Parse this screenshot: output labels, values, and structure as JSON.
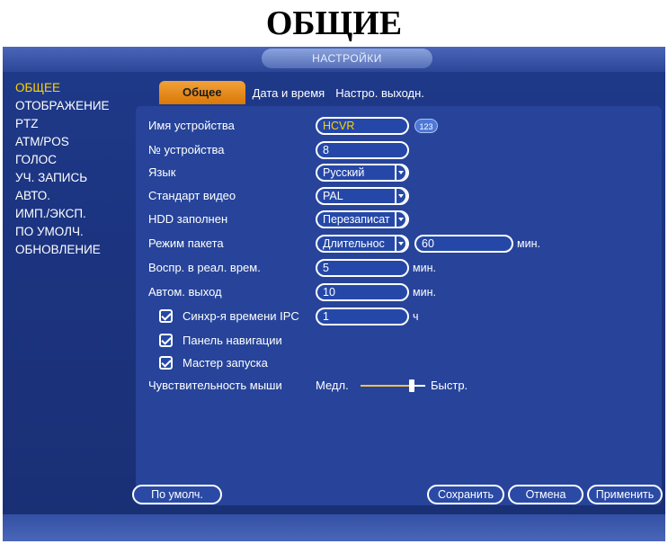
{
  "page_heading": "ОБЩИЕ",
  "window_title": "НАСТРОЙКИ",
  "sidebar": {
    "items": [
      {
        "label": "ОБЩЕЕ",
        "active": true
      },
      {
        "label": "ОТОБРАЖЕНИЕ"
      },
      {
        "label": "PTZ"
      },
      {
        "label": "ATM/POS"
      },
      {
        "label": "ГОЛОС"
      },
      {
        "label": "УЧ. ЗАПИСЬ"
      },
      {
        "label": "АВТО."
      },
      {
        "label": "ИМП./ЭКСП."
      },
      {
        "label": "ПО УМОЛЧ."
      },
      {
        "label": "ОБНОВЛЕНИЕ"
      }
    ]
  },
  "tabs": [
    {
      "label": "Общее",
      "active": true
    },
    {
      "label": "Дата и время"
    },
    {
      "label": "Настро. выходн."
    }
  ],
  "form": {
    "device_name": {
      "label": "Имя устройства",
      "value": "HCVR",
      "keyboard_badge": "123"
    },
    "device_number": {
      "label": "№ устройства",
      "value": "8"
    },
    "language": {
      "label": "Язык",
      "value": "Русский"
    },
    "video_standard": {
      "label": "Стандарт видео",
      "value": "PAL"
    },
    "hdd_full": {
      "label": "HDD заполнен",
      "value": "Перезаписат"
    },
    "pack_mode": {
      "label": "Режим пакета",
      "value": "Длительнос",
      "duration": "60",
      "unit": "мин."
    },
    "realtime_play": {
      "label": "Воспр. в реал. врем.",
      "value": "5",
      "unit": "мин."
    },
    "auto_logout": {
      "label": "Автом. выход",
      "value": "10",
      "unit": "мин."
    },
    "ipc_time_sync": {
      "label": "Синхр-я времени IPC",
      "checked": true,
      "value": "1",
      "unit": "ч"
    },
    "nav_bar": {
      "label": "Панель навигации",
      "checked": true
    },
    "startup_wizard": {
      "label": "Мастер запуска",
      "checked": true
    },
    "mouse_sensitivity": {
      "label": "Чувствительность мыши",
      "slow_label": "Медл.",
      "fast_label": "Быстр.",
      "level": 0.75
    }
  },
  "buttons": {
    "default": "По умолч.",
    "save": "Сохранить",
    "cancel": "Отмена",
    "apply": "Применить"
  },
  "colors": {
    "accent": "#ffd200",
    "tab_active": "#e98c1a",
    "slider": "#f4c144"
  }
}
